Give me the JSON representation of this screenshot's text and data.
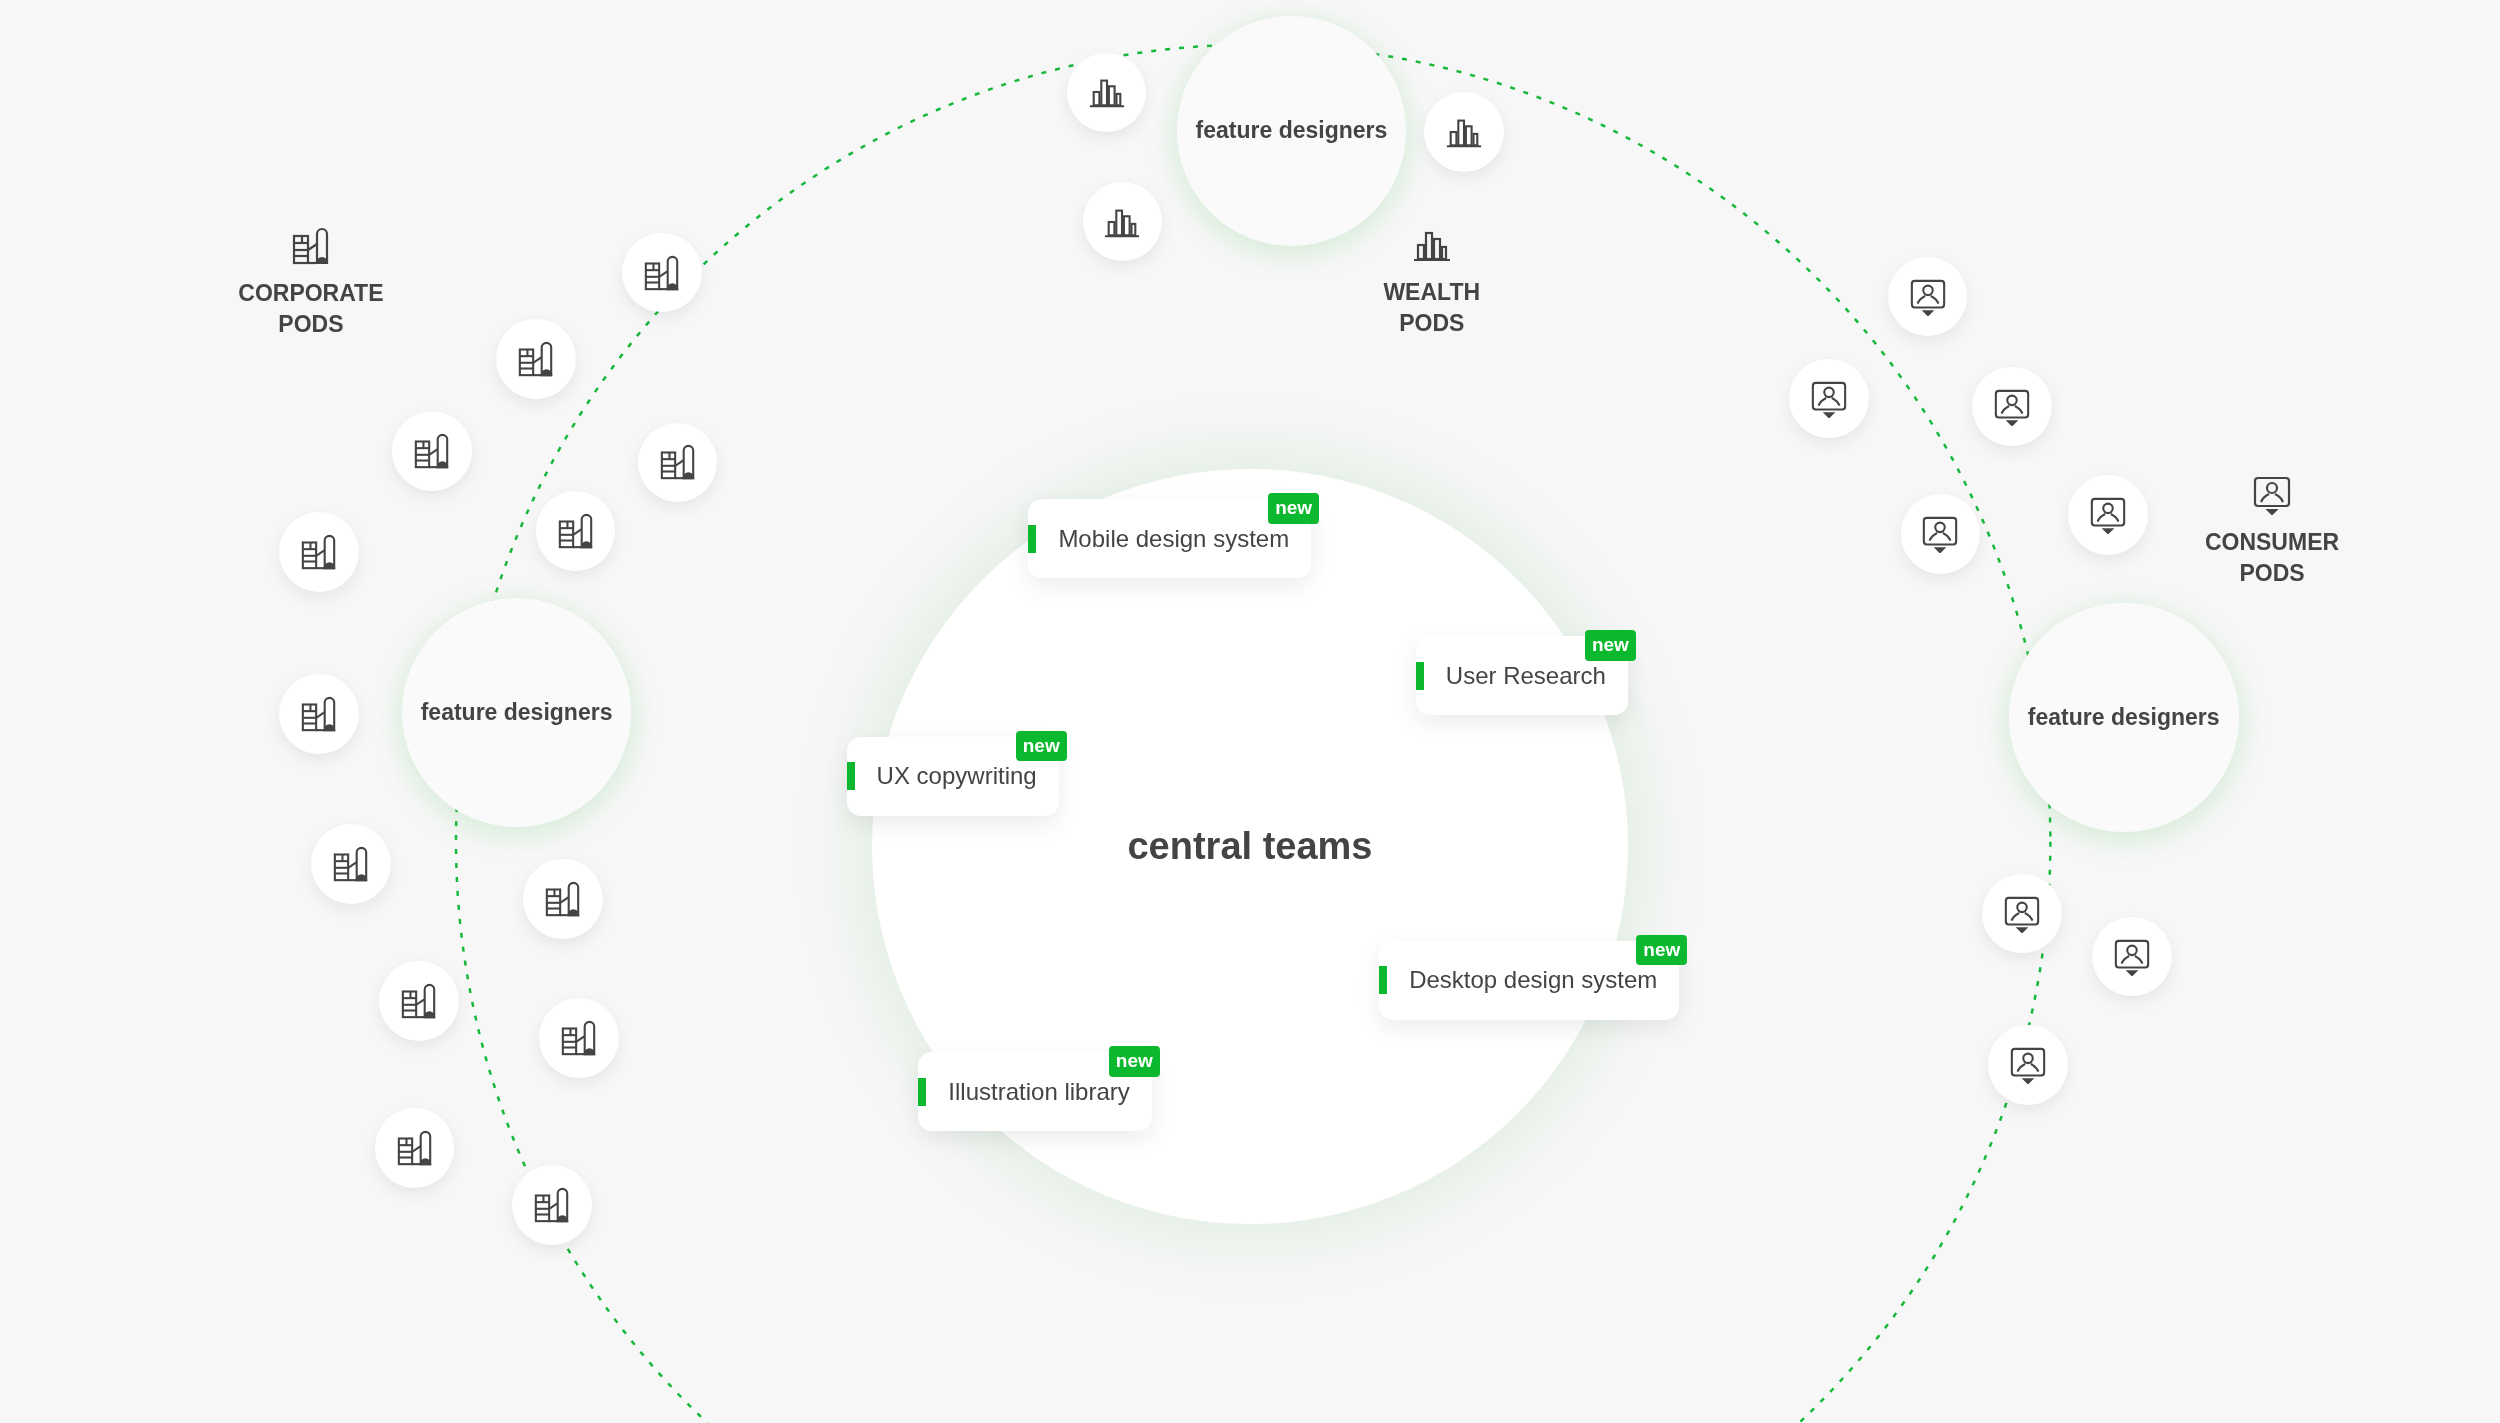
{
  "center": {
    "title": "central teams"
  },
  "feature_groups": [
    {
      "label": "feature designers"
    },
    {
      "label": "feature designers"
    },
    {
      "label": "feature designers"
    }
  ],
  "pods": [
    {
      "label": "CORPORATE PODS"
    },
    {
      "label": "WEALTH PODS"
    },
    {
      "label": "CONSUMER PODS"
    }
  ],
  "teams": [
    {
      "title": "Mobile design system",
      "badge": "new"
    },
    {
      "title": "User Research",
      "badge": "new"
    },
    {
      "title": "UX copywriting",
      "badge": "new"
    },
    {
      "title": "Desktop design system",
      "badge": "new"
    },
    {
      "title": "Illustration library",
      "badge": "new"
    }
  ]
}
